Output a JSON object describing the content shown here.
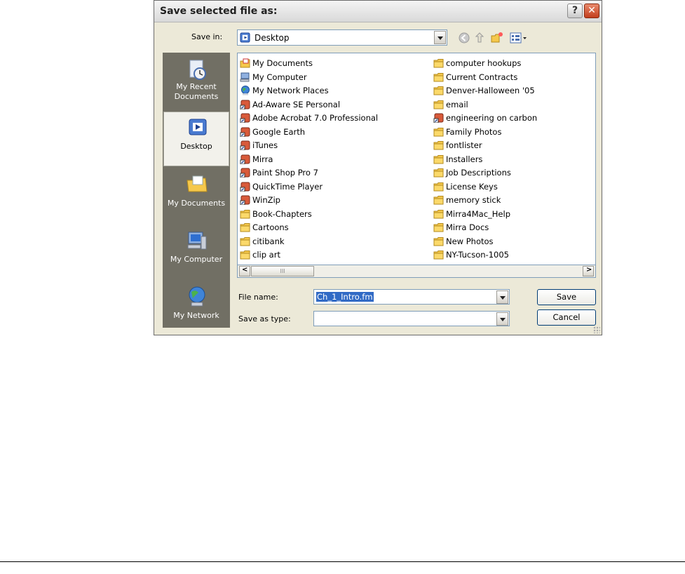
{
  "dialog": {
    "title": "Save selected file as:",
    "help_label": "?",
    "close_label": "✕"
  },
  "save_in": {
    "label": "Save in:",
    "value": "Desktop"
  },
  "places": [
    {
      "label": "My Recent Documents",
      "icon": "recent-documents-icon"
    },
    {
      "label": "Desktop",
      "icon": "desktop-icon"
    },
    {
      "label": "My Documents",
      "icon": "my-documents-icon"
    },
    {
      "label": "My Computer",
      "icon": "my-computer-icon"
    },
    {
      "label": "My Network",
      "icon": "network-icon"
    }
  ],
  "files_left": [
    {
      "name": "My Documents",
      "icon": "my-documents-icon"
    },
    {
      "name": "My Computer",
      "icon": "my-computer-icon"
    },
    {
      "name": "My Network Places",
      "icon": "network-icon"
    },
    {
      "name": "Ad-Aware SE Personal",
      "icon": "shortcut-icon"
    },
    {
      "name": "Adobe Acrobat 7.0 Professional",
      "icon": "shortcut-icon"
    },
    {
      "name": "Google Earth",
      "icon": "shortcut-icon"
    },
    {
      "name": "iTunes",
      "icon": "shortcut-icon"
    },
    {
      "name": "Mirra",
      "icon": "shortcut-icon"
    },
    {
      "name": "Paint Shop Pro 7",
      "icon": "shortcut-icon"
    },
    {
      "name": "QuickTime Player",
      "icon": "shortcut-icon"
    },
    {
      "name": "WinZip",
      "icon": "shortcut-icon"
    },
    {
      "name": "Book-Chapters",
      "icon": "folder-icon"
    },
    {
      "name": "Cartoons",
      "icon": "folder-icon"
    },
    {
      "name": "citibank",
      "icon": "folder-icon"
    },
    {
      "name": "clip art",
      "icon": "folder-icon"
    }
  ],
  "files_right": [
    {
      "name": "computer hookups",
      "icon": "folder-icon"
    },
    {
      "name": "Current Contracts",
      "icon": "folder-icon"
    },
    {
      "name": "Denver-Halloween '05",
      "icon": "folder-icon"
    },
    {
      "name": "email",
      "icon": "folder-icon"
    },
    {
      "name": "engineering on carbon",
      "icon": "shortcut-icon"
    },
    {
      "name": "Family Photos",
      "icon": "folder-icon"
    },
    {
      "name": "fontlister",
      "icon": "folder-icon"
    },
    {
      "name": "Installers",
      "icon": "folder-icon"
    },
    {
      "name": "Job Descriptions",
      "icon": "folder-icon"
    },
    {
      "name": "License Keys",
      "icon": "folder-icon"
    },
    {
      "name": "memory stick",
      "icon": "folder-icon"
    },
    {
      "name": "Mirra4Mac_Help",
      "icon": "folder-icon"
    },
    {
      "name": "Mirra Docs",
      "icon": "folder-icon"
    },
    {
      "name": "New Photos",
      "icon": "folder-icon"
    },
    {
      "name": "NY-Tucson-1005",
      "icon": "folder-icon"
    }
  ],
  "file_name": {
    "label": "File name:",
    "value": "Ch_1_Intro.fm"
  },
  "save_as_type": {
    "label": "Save as type:",
    "value": ""
  },
  "buttons": {
    "save": "Save",
    "cancel": "Cancel"
  },
  "scrollbar": {
    "left": "<",
    "right": ">",
    "thumb": "III"
  },
  "colors": {
    "dialog_bg": "#ece9d8",
    "places_bg": "#716f64",
    "selection": "#316ac5",
    "folder": "#f5c84c",
    "close_red": "#c23e1d"
  }
}
